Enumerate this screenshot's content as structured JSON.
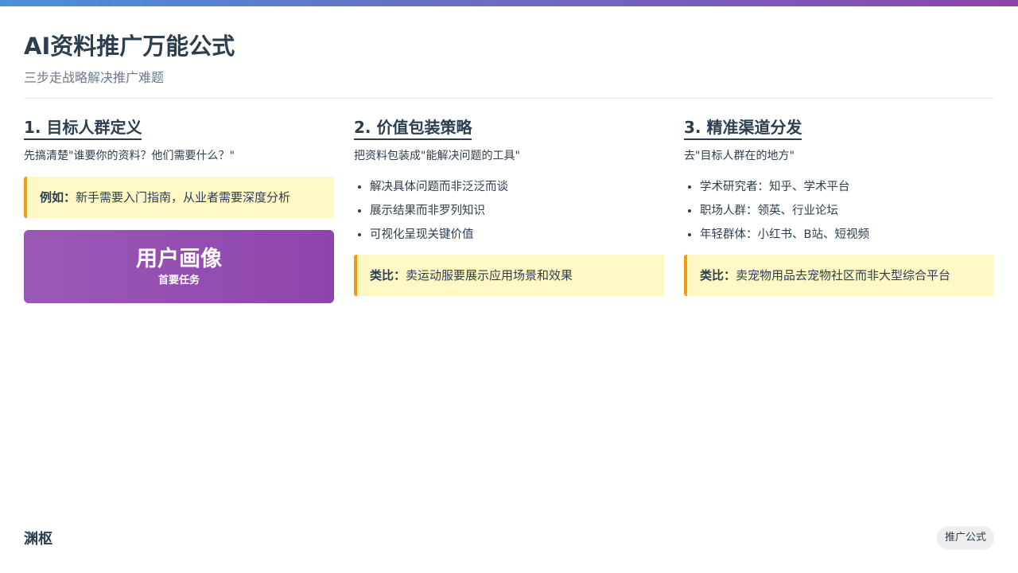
{
  "colors": {
    "accent_bar_start": "#4a90d9",
    "accent_bar_end": "#8e44ad",
    "callout_bg": "#fff8c4",
    "callout_border": "#f39c12",
    "persona_card": "#8e44ad"
  },
  "header": {
    "title": "AI资料推广万能公式",
    "subtitle": "三步走战略解决推广难题"
  },
  "columns": [
    {
      "title": "1. 目标人群定义",
      "desc": "先搞清楚\"谁要你的资料？他们需要什么？\"",
      "callout_label": "例如：",
      "callout_text": "新手需要入门指南，从业者需要深度分析",
      "card_title": "用户画像",
      "card_sub": "首要任务"
    },
    {
      "title": "2. 价值包装策略",
      "desc": "把资料包装成\"能解决问题的工具\"",
      "bullets": [
        "解决具体问题而非泛泛而谈",
        "展示结果而非罗列知识",
        "可视化呈现关键价值"
      ],
      "callout_label": "类比：",
      "callout_text": "卖运动服要展示应用场景和效果"
    },
    {
      "title": "3. 精准渠道分发",
      "desc": "去\"目标人群在的地方\"",
      "bullets": [
        "学术研究者：知乎、学术平台",
        "职场人群：领英、行业论坛",
        "年轻群体：小红书、B站、短视频"
      ],
      "callout_label": "类比：",
      "callout_text": "卖宠物用品去宠物社区而非大型综合平台"
    }
  ],
  "footer": {
    "brand": "渊枢",
    "tag": "推广公式"
  }
}
